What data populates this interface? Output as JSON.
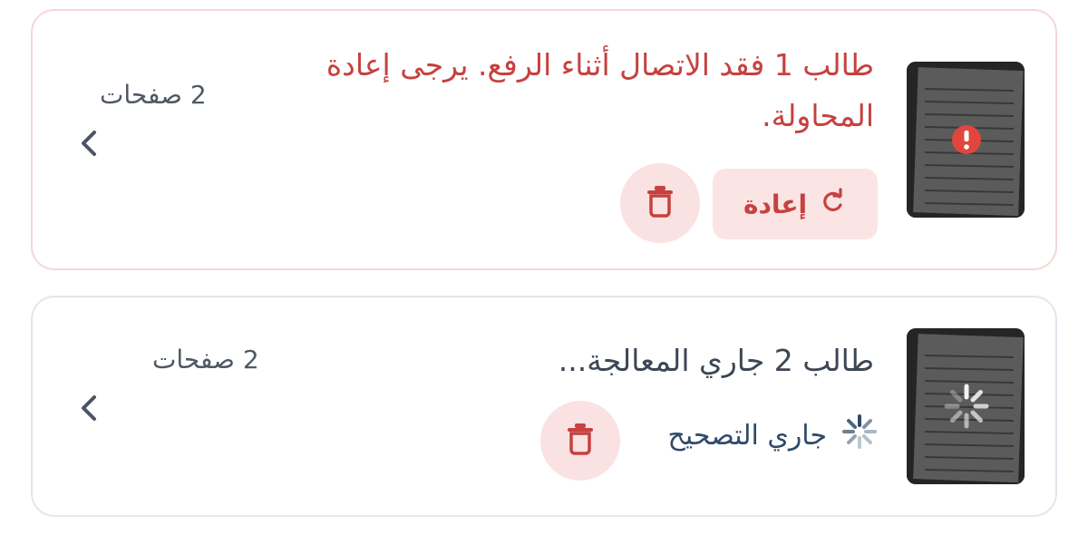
{
  "items": [
    {
      "title": "طالب 1 فقد الاتصال أثناء الرفع. يرجى إعادة المحاولة.",
      "pages": "2 صفحات",
      "retry_label": "إعادة",
      "state": "error",
      "icons": {
        "status": "error-icon",
        "retry": "refresh-icon",
        "delete": "trash-icon",
        "chevron": "chevron-left-icon"
      },
      "colors": {
        "accent": "#c6413f",
        "soft": "#fbe4e4"
      }
    },
    {
      "title": "طالب 2 جاري المعالجة...",
      "pages": "2 صفحات",
      "status_label": "جاري التصحيح",
      "state": "processing",
      "icons": {
        "status": "spinner-icon",
        "delete": "trash-icon",
        "chevron": "chevron-left-icon"
      },
      "colors": {
        "accent": "#2f4a6a",
        "soft": "#fbe2e2"
      }
    }
  ]
}
